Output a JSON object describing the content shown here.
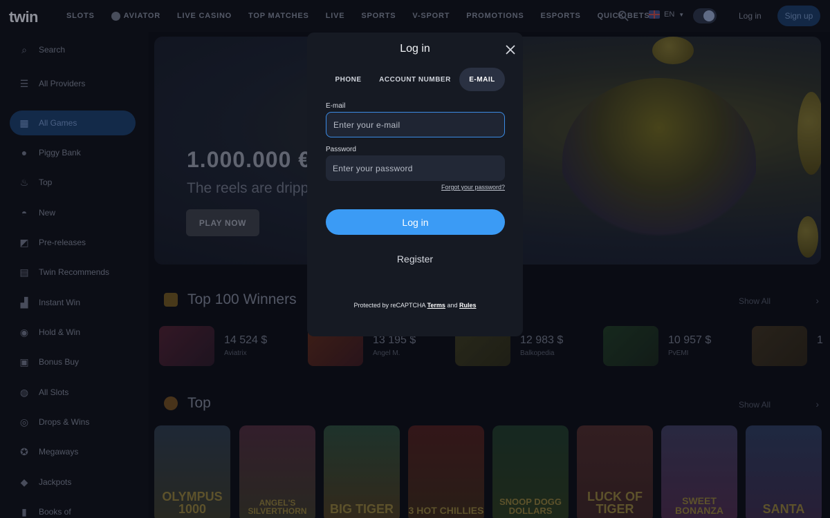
{
  "header": {
    "logo": "twin",
    "nav": [
      "SLOTS",
      "AVIATOR",
      "LIVE CASINO",
      "TOP MATCHES",
      "LIVE",
      "SPORTS",
      "V-SPORT",
      "PROMOTIONS",
      "ESPORTS",
      "QUICK BETS"
    ],
    "language": "EN",
    "login": "Log in",
    "signup": "Sign up"
  },
  "sidebar": {
    "items": [
      {
        "label": "Search",
        "icon": "search-icon"
      },
      {
        "label": "All Providers",
        "icon": "list-icon"
      },
      {
        "label": "All Games",
        "icon": "grid-icon"
      },
      {
        "label": "Piggy Bank",
        "icon": "piggy-icon"
      },
      {
        "label": "Top",
        "icon": "flame-icon"
      },
      {
        "label": "New",
        "icon": "new-icon"
      },
      {
        "label": "Pre-releases",
        "icon": "release-icon"
      },
      {
        "label": "Twin Recommends",
        "icon": "recommend-icon"
      },
      {
        "label": "Instant Win",
        "icon": "chart-icon"
      },
      {
        "label": "Hold & Win",
        "icon": "coin-icon"
      },
      {
        "label": "Bonus Buy",
        "icon": "cart-icon"
      },
      {
        "label": "All Slots",
        "icon": "slot-icon"
      },
      {
        "label": "Drops & Wins",
        "icon": "drop-icon"
      },
      {
        "label": "Megaways",
        "icon": "megaways-icon"
      },
      {
        "label": "Jackpots",
        "icon": "jackpot-icon"
      },
      {
        "label": "Books of",
        "icon": "book-icon"
      }
    ]
  },
  "banner": {
    "amount": "1.000.000 €",
    "subtitle": "The reels are drippi",
    "cta": "PLAY NOW"
  },
  "winners": {
    "title": "Top 100 Winners",
    "show_all": "Show All",
    "items": [
      {
        "amount": "14 524 $",
        "user": "Aviatrix"
      },
      {
        "amount": "13 195 $",
        "user": "Angel M."
      },
      {
        "amount": "12 983 $",
        "user": "Balkopedia"
      },
      {
        "amount": "10 957 $",
        "user": "PvEMI"
      },
      {
        "amount": "1",
        "user": ""
      }
    ]
  },
  "top": {
    "title": "Top",
    "show_all": "Show All",
    "games": [
      "OLYMPUS 1000",
      "ANGEL'S SILVERTHORN",
      "BIG TIGER",
      "3 HOT CHILLIES",
      "SNOOP DOGG DOLLARS",
      "LUCK OF TIGER",
      "SWEET BONANZA",
      "SANTA"
    ]
  },
  "modal": {
    "title": "Log in",
    "tabs": [
      "PHONE",
      "ACCOUNT NUMBER",
      "E-MAIL"
    ],
    "email_label": "E-mail",
    "email_placeholder": "Enter your e-mail",
    "password_label": "Password",
    "password_placeholder": "Enter your password",
    "forgot": "Forgot your password?",
    "login_button": "Log in",
    "register": "Register",
    "recaptcha_prefix": "Protected by reCAPTCHA",
    "recaptcha_terms": "Terms",
    "recaptcha_and": "and",
    "recaptcha_rules": "Rules"
  },
  "colors": {
    "accent": "#3b9bf5",
    "modal_bg": "#161a23",
    "page_bg": "#0c0e16"
  }
}
